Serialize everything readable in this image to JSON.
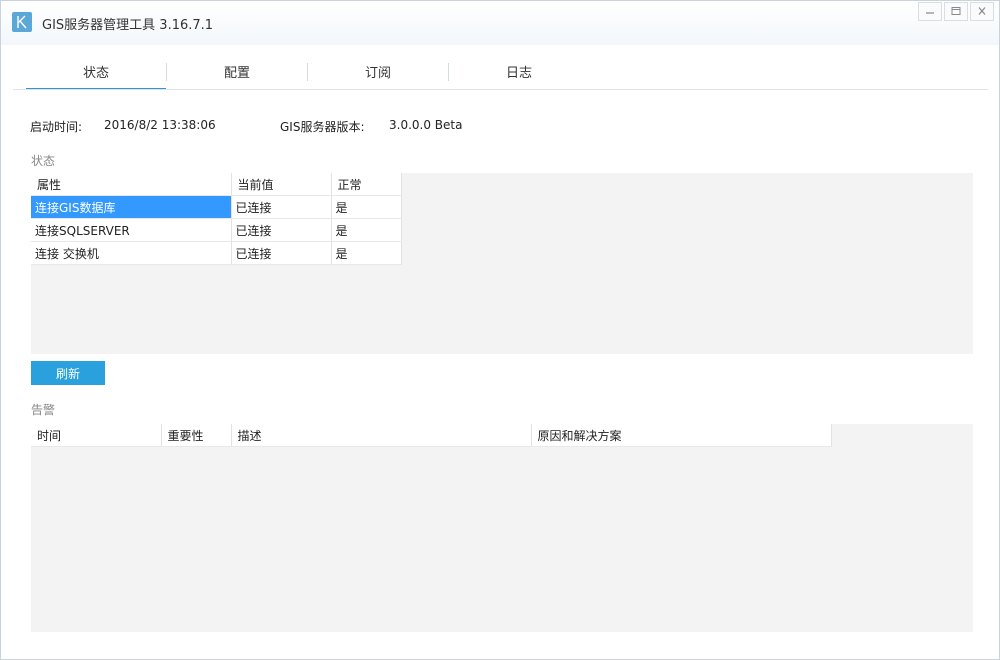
{
  "window": {
    "title": "GIS服务器管理工具 3.16.7.1"
  },
  "tabs": [
    {
      "label": "状态",
      "active": true
    },
    {
      "label": "配置",
      "active": false
    },
    {
      "label": "订阅",
      "active": false
    },
    {
      "label": "日志",
      "active": false
    }
  ],
  "info": {
    "start_time_label": "启动时间:",
    "start_time_value": "2016/8/2 13:38:06",
    "version_label": "GIS服务器版本:",
    "version_value": "3.0.0.0 Beta"
  },
  "status_section": {
    "label": "状态",
    "columns": [
      "属性",
      "当前值",
      "正常"
    ],
    "rows": [
      {
        "property": "连接GIS数据库",
        "value": "已连接",
        "normal": "是",
        "selected": true
      },
      {
        "property": "连接SQLSERVER",
        "value": "已连接",
        "normal": "是",
        "selected": false
      },
      {
        "property": "连接 交换机",
        "value": "已连接",
        "normal": "是",
        "selected": false
      }
    ]
  },
  "refresh_button": {
    "label": "刷新"
  },
  "alarm_section": {
    "label": "告警",
    "columns": [
      "时间",
      "重要性",
      "描述",
      "原因和解决方案"
    ]
  },
  "colors": {
    "accent": "#2aa0dc",
    "selection": "#3399ff",
    "grid_background": "#f3f3f3"
  },
  "icons": {
    "app": "k-logo-icon",
    "minimize": "minimize-icon",
    "restore": "restore-icon",
    "close": "close-icon"
  }
}
